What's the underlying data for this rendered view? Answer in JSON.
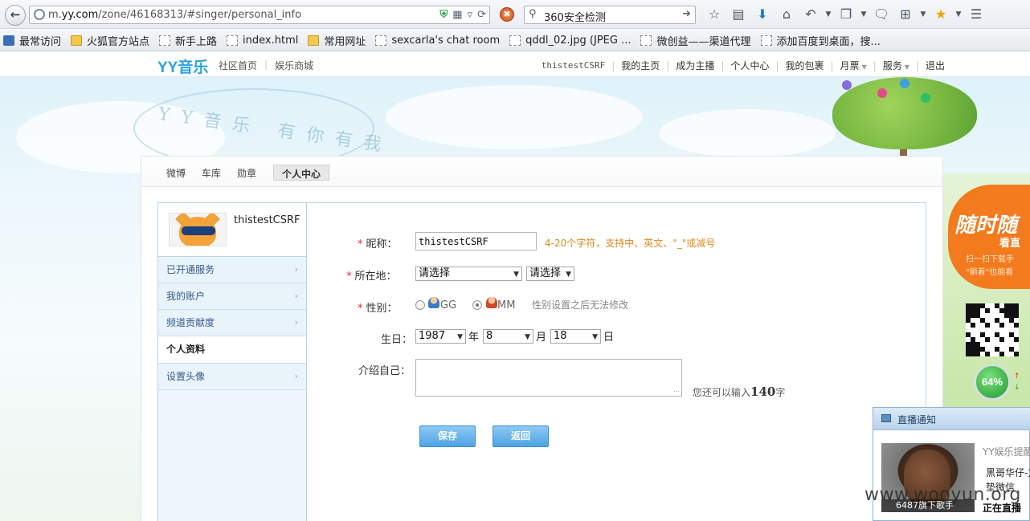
{
  "browser": {
    "url_prefix": "m.",
    "url_domain": "yy.com",
    "url_path": "/zone/46168313/#singer/personal_info",
    "search_text": "360安全检测"
  },
  "bookmarks": [
    {
      "label": "最常访问",
      "icon": "bookmark-icon"
    },
    {
      "label": "火狐官方站点",
      "icon": "folder-icon"
    },
    {
      "label": "新手上路",
      "icon": "page-icon"
    },
    {
      "label": "index.html",
      "icon": "page-icon"
    },
    {
      "label": "常用网址",
      "icon": "folder-icon"
    },
    {
      "label": "sexcarla's chat room",
      "icon": "page-icon"
    },
    {
      "label": "qddl_02.jpg (JPEG ...",
      "icon": "page-icon"
    },
    {
      "label": "微创益——渠道代理",
      "icon": "page-icon"
    },
    {
      "label": "添加百度到桌面，搜...",
      "icon": "page-icon"
    }
  ],
  "site": {
    "logo": "YY音乐",
    "links": [
      "社区首页",
      "娱乐商城"
    ],
    "user_nav": {
      "username": "thistestCSRF",
      "my_home": "我的主页",
      "become_host": "成为主播",
      "personal_center": "个人中心",
      "my_package": "我的包裹",
      "monthly_ticket": "月票",
      "service": "服务",
      "logout": "退出"
    },
    "banner_slogan": "YY音乐 有你有我"
  },
  "tabs": [
    {
      "label": "微博",
      "active": false
    },
    {
      "label": "车库",
      "active": false
    },
    {
      "label": "勋章",
      "active": false
    },
    {
      "label": "个人中心",
      "active": true
    }
  ],
  "sidebar": {
    "username": "thistestCSRF",
    "items": [
      {
        "label": "已开通服务",
        "current": false
      },
      {
        "label": "我的账户",
        "current": false
      },
      {
        "label": "频道贡献度",
        "current": false
      },
      {
        "label": "个人资料",
        "current": true
      },
      {
        "label": "设置头像",
        "current": false
      }
    ]
  },
  "form": {
    "nickname_label": "昵称：",
    "nickname_value": "thistestCSRF",
    "nickname_hint": "4-20个字符，支持中、英文、\"_\"或减号",
    "location_label": "所在地：",
    "location_province": "请选择",
    "location_city": "请选择",
    "gender_label": "性别：",
    "gender_male": "GG",
    "gender_female": "MM",
    "gender_selected": "MM",
    "gender_hint": "性别设置之后无法修改",
    "birthday_label": "生日：",
    "birth_year": "1987",
    "year_unit": "年",
    "birth_month": "8",
    "month_unit": "月",
    "birth_day": "18",
    "day_unit": "日",
    "intro_label": "介绍自己：",
    "intro_value": "",
    "remaining_prefix": "您还可以输入",
    "remaining_count": "140",
    "remaining_suffix": "字",
    "save_label": "保存",
    "back_label": "返回"
  },
  "promo": {
    "title": "随时随",
    "subtitle": "看直",
    "line1": "扫一扫下载手",
    "line2": "\"躺着\"也能看"
  },
  "speed_widget": {
    "percent": "64%"
  },
  "notification": {
    "title": "直播通知",
    "sender": "YY娱乐提醒",
    "line1": "黑哥华仔-方",
    "line2": "垫微信",
    "photo_caption": "6487旗下歌手",
    "status": "正在直播"
  },
  "watermark": "www.wooyun.org",
  "colors": {
    "accent_blue": "#4ea3e3",
    "required_red": "#e02a2a",
    "hint_orange": "#e08a20",
    "promo_orange": "#f47a1e"
  }
}
